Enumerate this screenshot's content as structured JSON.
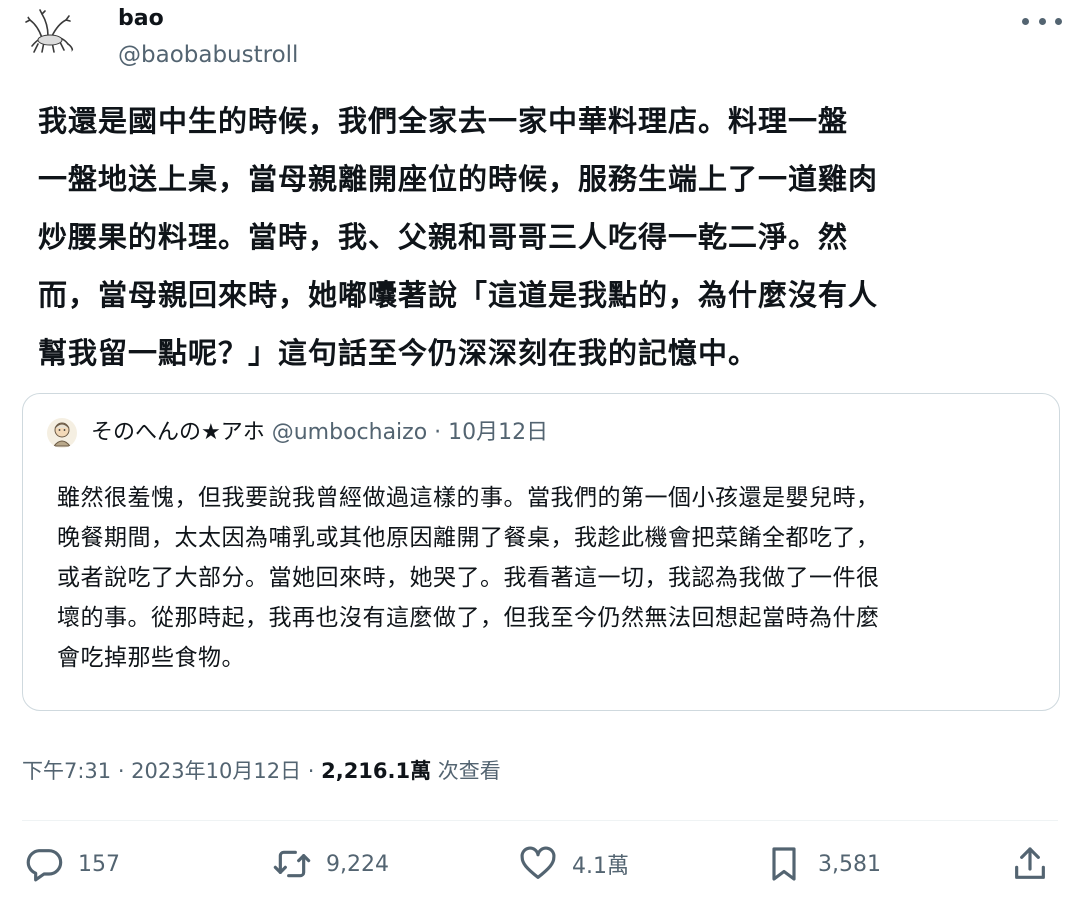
{
  "author": {
    "name": "bao",
    "handle": "@baobabustroll"
  },
  "tweet": {
    "text": "我還是國中生的時候，我們全家去一家中華料理店。料理一盤\n一盤地送上桌，當母親離開座位的時候，服務生端上了一道雞肉\n炒腰果的料理。當時，我、父親和哥哥三人吃得一乾二淨。然\n而，當母親回來時，她嘟囔著說「這道是我點的，為什麼沒有人\n幫我留一點呢？」這句話至今仍深深刻在我的記憶中。"
  },
  "quote": {
    "name": "そのへんの★アホ",
    "handle_date": "@umbochaizo · 10月12日",
    "text": "雖然很羞愧，但我要說我曾經做過這樣的事。當我們的第一個小孩還是嬰兒時，\n晚餐期間，太太因為哺乳或其他原因離開了餐桌，我趁此機會把菜餚全都吃了，\n或者說吃了大部分。當她回來時，她哭了。我看著這一切，我認為我做了一件很\n壞的事。從那時起，我再也沒有這麼做了，但我至今仍然無法回想起當時為什麼\n會吃掉那些食物。"
  },
  "meta": {
    "time_date": "下午7:31 · 2023年10月12日 · ",
    "views_count": "2,216.1萬",
    "views_label": " 次查看"
  },
  "actions": {
    "replies": "157",
    "retweets": "9,224",
    "likes": "4.1萬",
    "bookmarks": "3,581"
  },
  "icons": [
    "more-icon",
    "reply-icon",
    "retweet-icon",
    "like-icon",
    "bookmark-icon",
    "share-icon"
  ]
}
